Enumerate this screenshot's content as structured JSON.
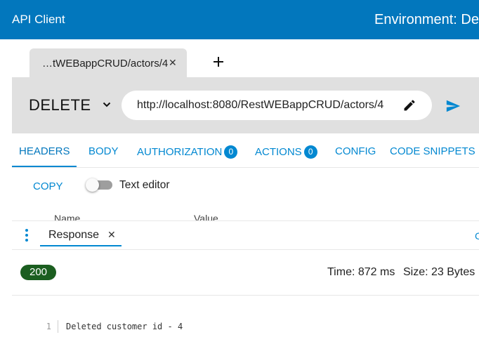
{
  "app": {
    "title": "API Client",
    "environment_label": "Environment: Def",
    "brand_color": "#0277bd"
  },
  "request_tabs": [
    {
      "label": "…tWEBappCRUD/actors/4",
      "close": "✕",
      "active": true
    }
  ],
  "add_tab_icon": "plus-icon",
  "request": {
    "method": "DELETE",
    "url": "http://localhost:8080/RestWEBappCRUD/actors/4",
    "edit_icon": "pencil-icon",
    "send_icon": "send-icon"
  },
  "request_section_tabs": [
    {
      "label": "HEADERS",
      "active": true
    },
    {
      "label": "BODY"
    },
    {
      "label": "AUTHORIZATION",
      "badge": "0"
    },
    {
      "label": "ACTIONS",
      "badge": "0"
    },
    {
      "label": "CONFIG"
    },
    {
      "label": "CODE SNIPPETS"
    }
  ],
  "headers_panel": {
    "copy_label": "COPY",
    "text_editor_label": "Text editor",
    "text_editor_enabled": false,
    "columns": [
      "Name",
      "Value"
    ]
  },
  "response_panel": {
    "tab_label": "Response",
    "close": "✕",
    "edge_text": "C",
    "status_code": "200",
    "status_color": "#1b5e20",
    "time_text": "Time: 872 ms",
    "size_text": "Size: 23 Bytes",
    "body_lines": [
      {
        "number": "1",
        "text": "Deleted customer id - 4"
      }
    ]
  }
}
